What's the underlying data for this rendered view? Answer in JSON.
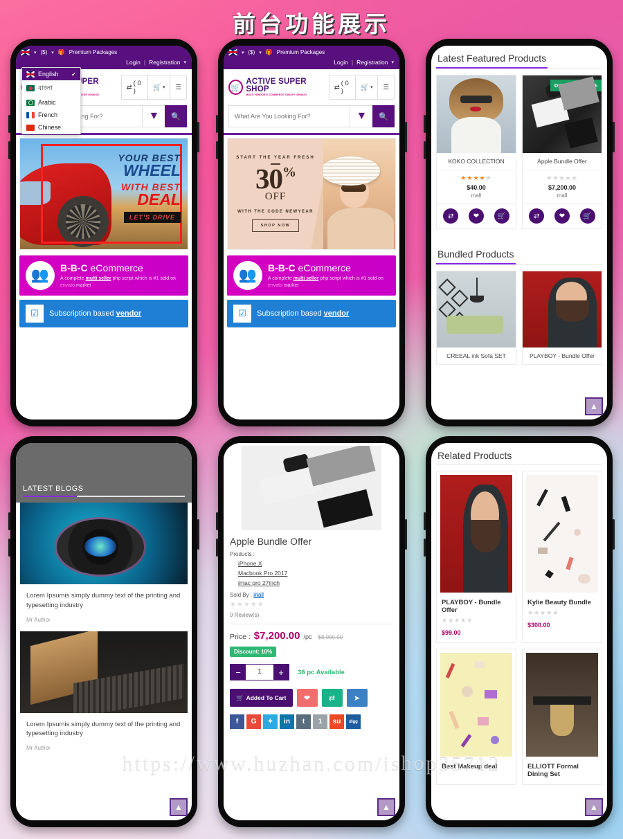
{
  "page": {
    "title": "前台功能展示",
    "watermark": "https://www.huzhan.com/ishop35712"
  },
  "store_header": {
    "currency": "($)",
    "premium_label": "Premium Packages",
    "login": "Login",
    "separator": "|",
    "registration": "Registration",
    "brand_name": "ACTIVE SUPER SHOP",
    "brand_tagline": "MULTI VENDOR E-COMMERCE CMS BY ISHAKIO",
    "compare_label": "( 0 )",
    "search_placeholder": "What Are You Looking For?"
  },
  "language_dropdown": {
    "items": [
      {
        "label": "English",
        "selected": true,
        "check": "✔"
      },
      {
        "label": "বাংলা",
        "selected": false
      },
      {
        "label": "Arabic",
        "selected": false
      },
      {
        "label": "French",
        "selected": false
      },
      {
        "label": "Chinese",
        "selected": false
      }
    ]
  },
  "banner_car": {
    "line1": "YOUR BEST",
    "line2": "WHEEL",
    "line3": "WITH BEST",
    "line4": "DEAL",
    "cta": "LET'S DRIVE"
  },
  "banner_offer": {
    "kicker": "START THE YEAR FRESH",
    "percent": "30",
    "percent_symbol": "%",
    "off": "OFF",
    "code_line": "WITH THE CODE NEWYEAR",
    "cta": "SHOP NOW"
  },
  "promo_bbc": {
    "title_bold": "B-B-C",
    "title_rest": "eCommerce",
    "desc_pre": "A complete ",
    "desc_bold": "multi seller",
    "desc_mid": " php script which is #1  sold on ",
    "desc_env": "envato",
    "desc_post": " market"
  },
  "promo_subscription": {
    "text_pre": "Subscription based ",
    "text_bold": "vendor"
  },
  "featured_section": {
    "title": "Latest Featured Products",
    "products": [
      {
        "name": "KOKO COLLECTION",
        "price": "$40.00",
        "seller": "mall",
        "rating": 4,
        "badge": null
      },
      {
        "name": "Apple Bundle Offer",
        "price": "$7,200.00",
        "seller": "mall",
        "rating": 0,
        "badge": "DISCOUNT 10 %"
      }
    ],
    "action_icons": [
      "compare-icon",
      "wishlist-icon",
      "cart-icon"
    ]
  },
  "bundled_section": {
    "title": "Bundled Products",
    "products": [
      {
        "name": "CREEAL ink Sofa SET"
      },
      {
        "name": "PLAYBOY - Bundle Offer"
      }
    ]
  },
  "blogs_section": {
    "title": "LATEST BLOGS",
    "posts": [
      {
        "text": "Lorem Ipsumis simply dummy text of the printing and typesetting industry",
        "author": "Mr Author"
      },
      {
        "text": "Lorem Ipsumis simply dummy text of the printing and typesetting industry",
        "author": "Mr Author"
      }
    ]
  },
  "product_detail": {
    "title": "Apple Bundle Offer",
    "products_label": "Products :",
    "bundle_items": [
      "iPhone X",
      "Macbook Pro 2017",
      "imac pro 27inch"
    ],
    "sold_by_label": "Sold By :",
    "sold_by_value": "mall",
    "rating": 0,
    "reviews": "0 Review(s)",
    "price_label": "Price :",
    "price": "$7,200.00",
    "unit": "/pc",
    "old_price": "$8,000.00",
    "discount": "Discount: 10%",
    "qty_minus": "−",
    "qty_value": "1",
    "qty_plus": "+",
    "availability": "38 pc Available",
    "cart_button": "Added To Cart",
    "side_buttons": [
      "wishlist-icon",
      "compare-icon",
      "share-icon"
    ],
    "social": [
      {
        "name": "facebook",
        "glyph": "f"
      },
      {
        "name": "google",
        "glyph": "G"
      },
      {
        "name": "twitter",
        "glyph": "✦"
      },
      {
        "name": "linkedin",
        "glyph": "in"
      },
      {
        "name": "tumblr",
        "glyph": "t"
      },
      {
        "name": "onenote",
        "glyph": "1"
      },
      {
        "name": "stumbleupon",
        "glyph": "su"
      },
      {
        "name": "digg",
        "glyph": "digg"
      }
    ]
  },
  "related_section": {
    "title": "Related Products",
    "products": [
      {
        "name": "PLAYBOY - Bundle Offer",
        "price": "$99.00",
        "rating": 0
      },
      {
        "name": "Kylie Beauty Bundle",
        "price": "$300.00",
        "rating": 0
      },
      {
        "name": "Best Makeup deal",
        "price": "",
        "rating": 0
      },
      {
        "name": "ELLIOTT Formal Dining Set",
        "price": "",
        "rating": 0
      }
    ]
  },
  "scroll_top": {
    "icon": "chevron-up-icon"
  },
  "colors": {
    "brand_purple": "#57107e",
    "accent_purple": "#8a2be2",
    "discount_green": "#2eb873",
    "price_pink": "#b3006b",
    "promo_magenta": "#d500c0",
    "promo_blue": "#1f7fd4"
  }
}
